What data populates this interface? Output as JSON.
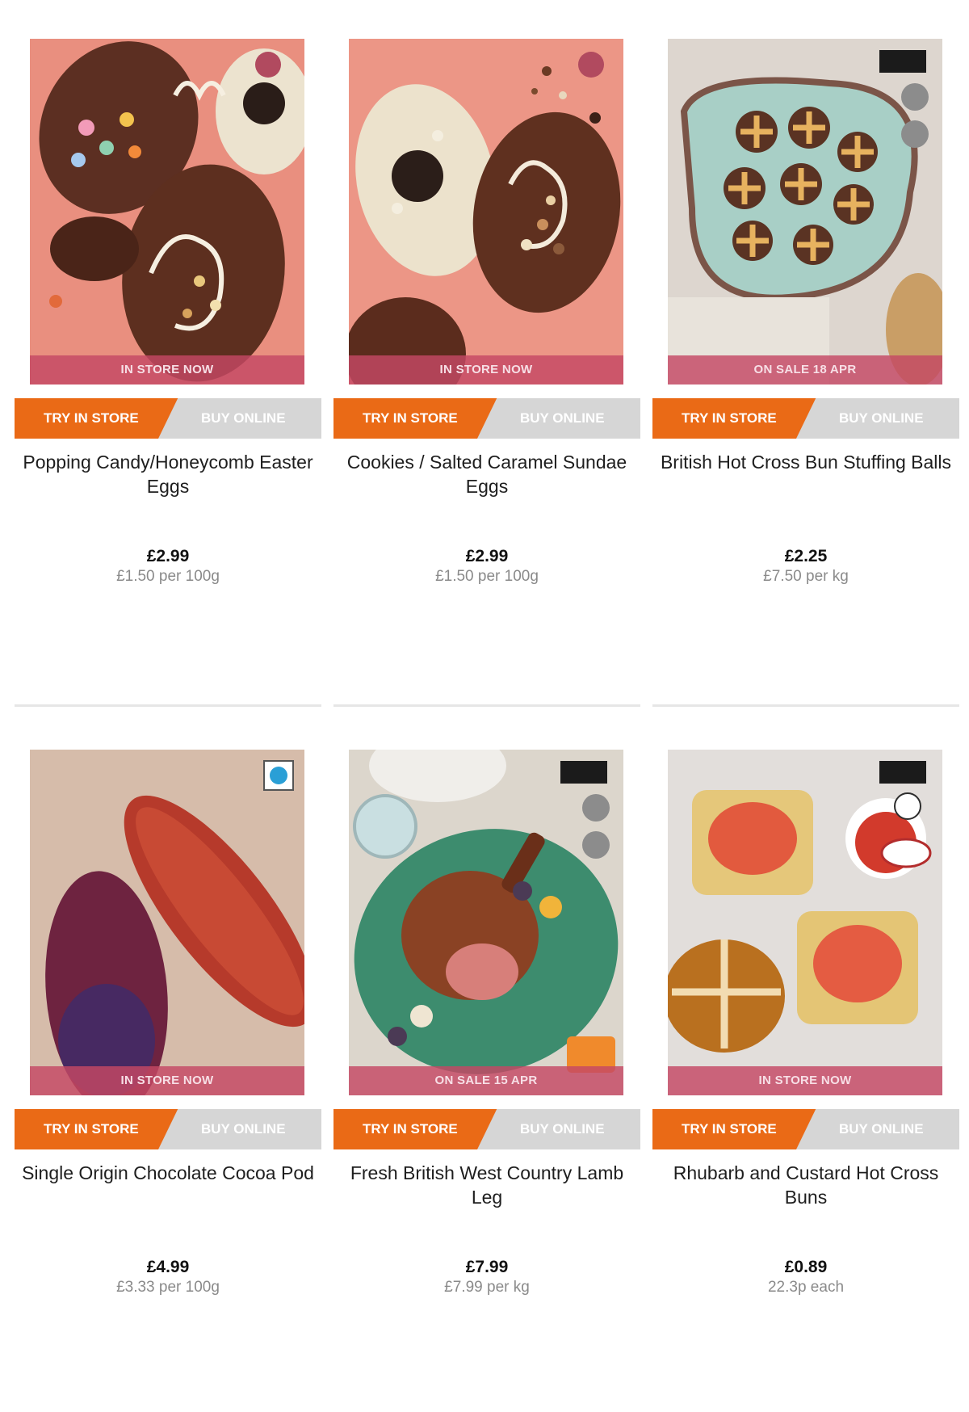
{
  "colors": {
    "try_in_store": "#ea6a16",
    "buy_online": "#d6d6d6",
    "banner": "#c44864",
    "unit_price_text": "#8a8a8a"
  },
  "products": [
    {
      "name": "Popping Candy/Honeycomb Easter Eggs",
      "badge": "IN STORE NOW",
      "try_label": "TRY IN STORE",
      "buy_label": "BUY ONLINE",
      "price": "£2.99",
      "unit_price": "£1.50 per 100g",
      "image": "chocolate-easter-eggs-image"
    },
    {
      "name": "Cookies / Salted Caramel Sundae Eggs",
      "badge": "IN STORE NOW",
      "try_label": "TRY IN STORE",
      "buy_label": "BUY ONLINE",
      "price": "£2.99",
      "unit_price": "£1.50 per 100g",
      "image": "sundae-eggs-image"
    },
    {
      "name": "British Hot Cross Bun Stuffing Balls",
      "badge": "ON SALE 18 APR",
      "try_label": "TRY IN STORE",
      "buy_label": "BUY ONLINE",
      "price": "£2.25",
      "unit_price": "£7.50 per kg",
      "image": "stuffing-balls-image"
    },
    {
      "name": "Single Origin Chocolate Cocoa Pod",
      "badge": "IN STORE NOW",
      "try_label": "TRY IN STORE",
      "buy_label": "BUY ONLINE",
      "price": "£4.99",
      "unit_price": "£3.33 per 100g",
      "image": "cocoa-pod-image"
    },
    {
      "name": "Fresh British West Country Lamb Leg",
      "badge": "ON SALE 15 APR",
      "try_label": "TRY IN STORE",
      "buy_label": "BUY ONLINE",
      "price": "£7.99",
      "unit_price": "£7.99 per kg",
      "image": "lamb-leg-image"
    },
    {
      "name": "Rhubarb and Custard Hot Cross Buns",
      "badge": "IN STORE NOW",
      "try_label": "TRY IN STORE",
      "buy_label": "BUY ONLINE",
      "price": "£0.89",
      "unit_price": "22.3p each",
      "image": "hot-cross-buns-image"
    }
  ]
}
